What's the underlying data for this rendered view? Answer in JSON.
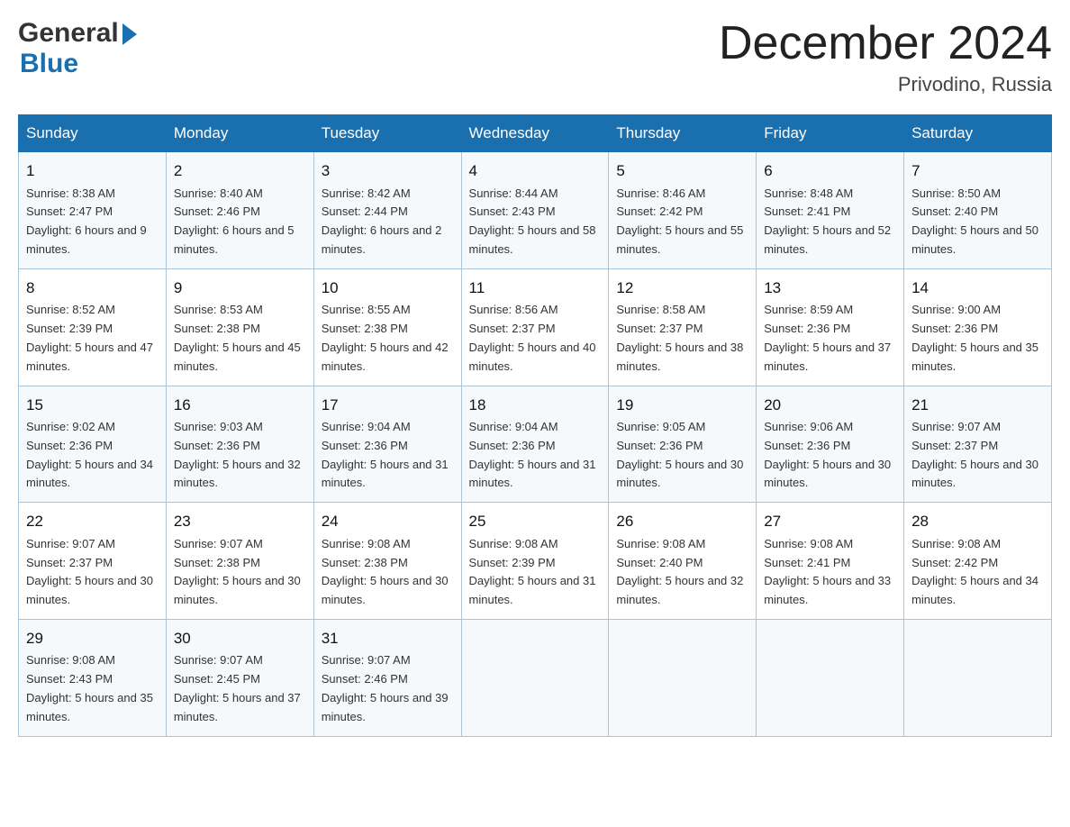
{
  "logo": {
    "text_general": "General",
    "triangle": "▶",
    "text_blue": "Blue"
  },
  "title": {
    "month_year": "December 2024",
    "location": "Privodino, Russia"
  },
  "days_of_week": [
    "Sunday",
    "Monday",
    "Tuesday",
    "Wednesday",
    "Thursday",
    "Friday",
    "Saturday"
  ],
  "weeks": [
    [
      {
        "day": "1",
        "sunrise": "8:38 AM",
        "sunset": "2:47 PM",
        "daylight": "6 hours and 9 minutes."
      },
      {
        "day": "2",
        "sunrise": "8:40 AM",
        "sunset": "2:46 PM",
        "daylight": "6 hours and 5 minutes."
      },
      {
        "day": "3",
        "sunrise": "8:42 AM",
        "sunset": "2:44 PM",
        "daylight": "6 hours and 2 minutes."
      },
      {
        "day": "4",
        "sunrise": "8:44 AM",
        "sunset": "2:43 PM",
        "daylight": "5 hours and 58 minutes."
      },
      {
        "day": "5",
        "sunrise": "8:46 AM",
        "sunset": "2:42 PM",
        "daylight": "5 hours and 55 minutes."
      },
      {
        "day": "6",
        "sunrise": "8:48 AM",
        "sunset": "2:41 PM",
        "daylight": "5 hours and 52 minutes."
      },
      {
        "day": "7",
        "sunrise": "8:50 AM",
        "sunset": "2:40 PM",
        "daylight": "5 hours and 50 minutes."
      }
    ],
    [
      {
        "day": "8",
        "sunrise": "8:52 AM",
        "sunset": "2:39 PM",
        "daylight": "5 hours and 47 minutes."
      },
      {
        "day": "9",
        "sunrise": "8:53 AM",
        "sunset": "2:38 PM",
        "daylight": "5 hours and 45 minutes."
      },
      {
        "day": "10",
        "sunrise": "8:55 AM",
        "sunset": "2:38 PM",
        "daylight": "5 hours and 42 minutes."
      },
      {
        "day": "11",
        "sunrise": "8:56 AM",
        "sunset": "2:37 PM",
        "daylight": "5 hours and 40 minutes."
      },
      {
        "day": "12",
        "sunrise": "8:58 AM",
        "sunset": "2:37 PM",
        "daylight": "5 hours and 38 minutes."
      },
      {
        "day": "13",
        "sunrise": "8:59 AM",
        "sunset": "2:36 PM",
        "daylight": "5 hours and 37 minutes."
      },
      {
        "day": "14",
        "sunrise": "9:00 AM",
        "sunset": "2:36 PM",
        "daylight": "5 hours and 35 minutes."
      }
    ],
    [
      {
        "day": "15",
        "sunrise": "9:02 AM",
        "sunset": "2:36 PM",
        "daylight": "5 hours and 34 minutes."
      },
      {
        "day": "16",
        "sunrise": "9:03 AM",
        "sunset": "2:36 PM",
        "daylight": "5 hours and 32 minutes."
      },
      {
        "day": "17",
        "sunrise": "9:04 AM",
        "sunset": "2:36 PM",
        "daylight": "5 hours and 31 minutes."
      },
      {
        "day": "18",
        "sunrise": "9:04 AM",
        "sunset": "2:36 PM",
        "daylight": "5 hours and 31 minutes."
      },
      {
        "day": "19",
        "sunrise": "9:05 AM",
        "sunset": "2:36 PM",
        "daylight": "5 hours and 30 minutes."
      },
      {
        "day": "20",
        "sunrise": "9:06 AM",
        "sunset": "2:36 PM",
        "daylight": "5 hours and 30 minutes."
      },
      {
        "day": "21",
        "sunrise": "9:07 AM",
        "sunset": "2:37 PM",
        "daylight": "5 hours and 30 minutes."
      }
    ],
    [
      {
        "day": "22",
        "sunrise": "9:07 AM",
        "sunset": "2:37 PM",
        "daylight": "5 hours and 30 minutes."
      },
      {
        "day": "23",
        "sunrise": "9:07 AM",
        "sunset": "2:38 PM",
        "daylight": "5 hours and 30 minutes."
      },
      {
        "day": "24",
        "sunrise": "9:08 AM",
        "sunset": "2:38 PM",
        "daylight": "5 hours and 30 minutes."
      },
      {
        "day": "25",
        "sunrise": "9:08 AM",
        "sunset": "2:39 PM",
        "daylight": "5 hours and 31 minutes."
      },
      {
        "day": "26",
        "sunrise": "9:08 AM",
        "sunset": "2:40 PM",
        "daylight": "5 hours and 32 minutes."
      },
      {
        "day": "27",
        "sunrise": "9:08 AM",
        "sunset": "2:41 PM",
        "daylight": "5 hours and 33 minutes."
      },
      {
        "day": "28",
        "sunrise": "9:08 AM",
        "sunset": "2:42 PM",
        "daylight": "5 hours and 34 minutes."
      }
    ],
    [
      {
        "day": "29",
        "sunrise": "9:08 AM",
        "sunset": "2:43 PM",
        "daylight": "5 hours and 35 minutes."
      },
      {
        "day": "30",
        "sunrise": "9:07 AM",
        "sunset": "2:45 PM",
        "daylight": "5 hours and 37 minutes."
      },
      {
        "day": "31",
        "sunrise": "9:07 AM",
        "sunset": "2:46 PM",
        "daylight": "5 hours and 39 minutes."
      },
      {
        "day": "",
        "sunrise": "",
        "sunset": "",
        "daylight": ""
      },
      {
        "day": "",
        "sunrise": "",
        "sunset": "",
        "daylight": ""
      },
      {
        "day": "",
        "sunrise": "",
        "sunset": "",
        "daylight": ""
      },
      {
        "day": "",
        "sunrise": "",
        "sunset": "",
        "daylight": ""
      }
    ]
  ]
}
